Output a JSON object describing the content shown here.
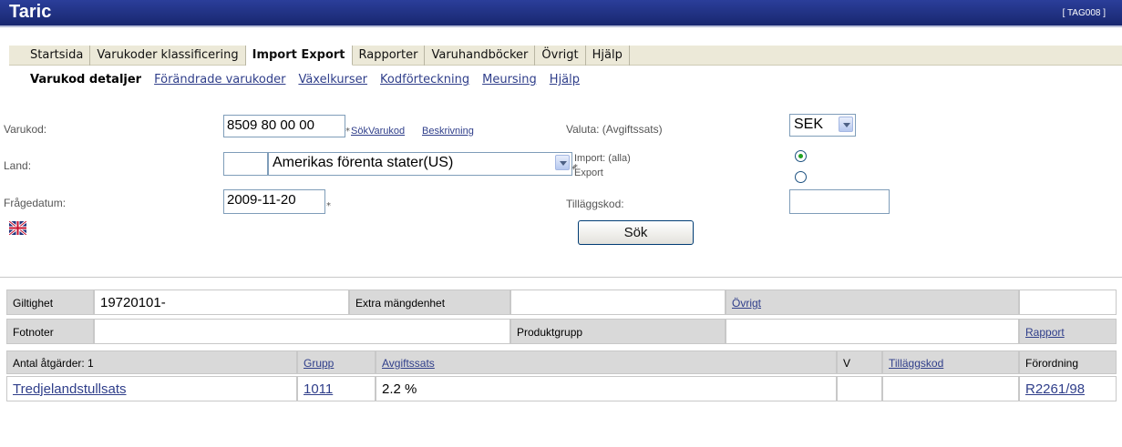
{
  "app": {
    "title": "Taric",
    "screen_code": "[ TAG008 ]"
  },
  "menu": [
    {
      "label": "Startsida",
      "active": false
    },
    {
      "label": "Varukoder klassificering",
      "active": false
    },
    {
      "label": "Import Export",
      "active": true
    },
    {
      "label": "Rapporter",
      "active": false
    },
    {
      "label": "Varuhandböcker",
      "active": false
    },
    {
      "label": "Övrigt",
      "active": false
    },
    {
      "label": "Hjälp",
      "active": false
    }
  ],
  "subnav": [
    {
      "label": "Varukod detaljer",
      "current": true
    },
    {
      "label": "Förändrade varukoder",
      "current": false
    },
    {
      "label": "Växelkurser",
      "current": false
    },
    {
      "label": "Kodförteckning",
      "current": false
    },
    {
      "label": "Meursing",
      "current": false
    },
    {
      "label": "Hjälp",
      "current": false
    }
  ],
  "form": {
    "varukod_label": "Varukod:",
    "varukod_value": "8509 80 00 00",
    "required_mark": "*",
    "sok_varukod_link": "SökVarukod",
    "beskrivning_link": "Beskrivning",
    "land_label": "Land:",
    "land_code_value": "",
    "land_selected": "Amerikas förenta stater(US)",
    "fragedatum_label": "Frågedatum:",
    "fragedatum_value": "2009-11-20",
    "valuta_label": "Valuta: (Avgiftssats)",
    "valuta_selected": "SEK",
    "import_label": "Import: (alla)",
    "export_label": "Export",
    "direction_selected": "Import",
    "tillaggskod_label": "Tilläggskod:",
    "tillaggskod_value": "",
    "search_button": "Sök",
    "language_flag": "uk-flag-icon"
  },
  "result": {
    "row1": {
      "giltighet_label": "Giltighet",
      "giltighet_value": "19720101-",
      "extra_label": "Extra mängdenhet",
      "extra_value": "",
      "ovrigt_link": "Övrigt",
      "ovrigt_value": ""
    },
    "row2": {
      "fotnoter_label": "Fotnoter",
      "fotnoter_value": "",
      "produktgrupp_label": "Produktgrupp",
      "produktgrupp_value": "",
      "rapport_link": "Rapport"
    },
    "headers": {
      "antal": "Antal åtgärder: 1",
      "grupp": "Grupp",
      "avgiftssats": "Avgiftssats",
      "v": "V",
      "tillaggskod": "Tilläggskod",
      "forordning": "Förordning"
    },
    "rows": [
      {
        "atgard": "Tredjelandstullsats",
        "grupp": "1011",
        "avgiftssats": "2.2 %",
        "v": "",
        "tillaggskod": "",
        "forordning": "R2261/98"
      }
    ]
  },
  "colors": {
    "titlebar": "#1f2f82",
    "menu_bg": "#ece9d8",
    "link": "#2f3e8a",
    "grid_header": "#d9d9d9"
  }
}
